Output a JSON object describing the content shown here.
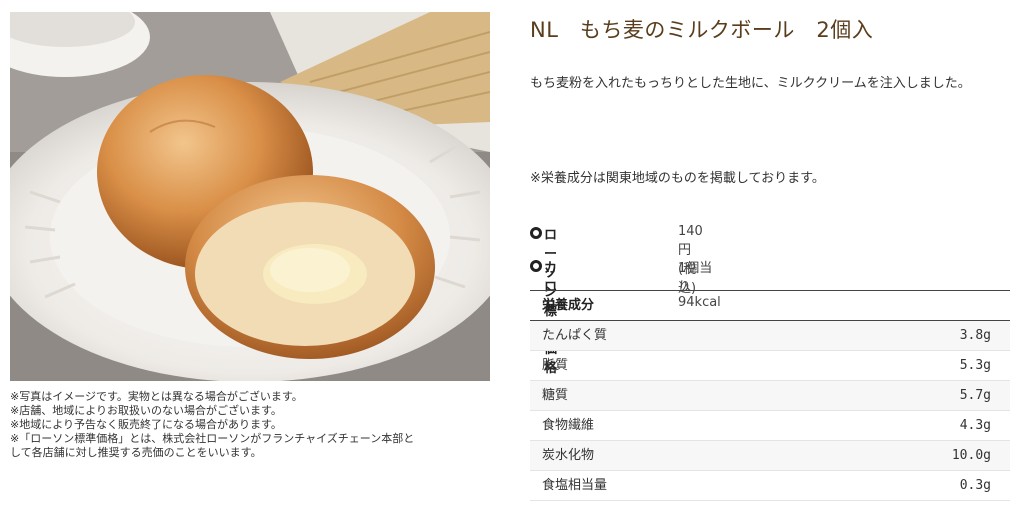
{
  "product": {
    "title": "NL　もち麦のミルクボール　2個入",
    "description": "もち麦粉を入れたもっちりとした生地に、ミルククリームを注入しました。",
    "nutrition_note": "※栄養成分は関東地域のものを掲載しております。"
  },
  "image_notes": [
    "※写真はイメージです。実物とは異なる場合がございます。",
    "※店舗、地域によりお取扱いのない場合がございます。",
    "※地域により予告なく販売終了になる場合があります。",
    "※「ローソン標準価格」とは、株式会社ローソンがフランチャイズチェーン本部と",
    "して各店舗に対し推奨する売価のことをいいます。"
  ],
  "info": {
    "price_label": "ローソン標準価格",
    "price_value": "140円(税込)",
    "calorie_label": "カロリー",
    "calorie_value": "1個当り94kcal"
  },
  "nutrition": {
    "header": "栄養成分",
    "rows": [
      {
        "name": "たんぱく質",
        "value": "3.8g"
      },
      {
        "name": "脂質",
        "value": "5.3g"
      },
      {
        "name": "糖質",
        "value": "5.7g"
      },
      {
        "name": "食物繊維",
        "value": "4.3g"
      },
      {
        "name": "炭水化物",
        "value": "10.0g"
      },
      {
        "name": "食塩相当量",
        "value": "0.3g"
      }
    ]
  },
  "icons": {
    "bullet": "circle-bullet-icon"
  }
}
